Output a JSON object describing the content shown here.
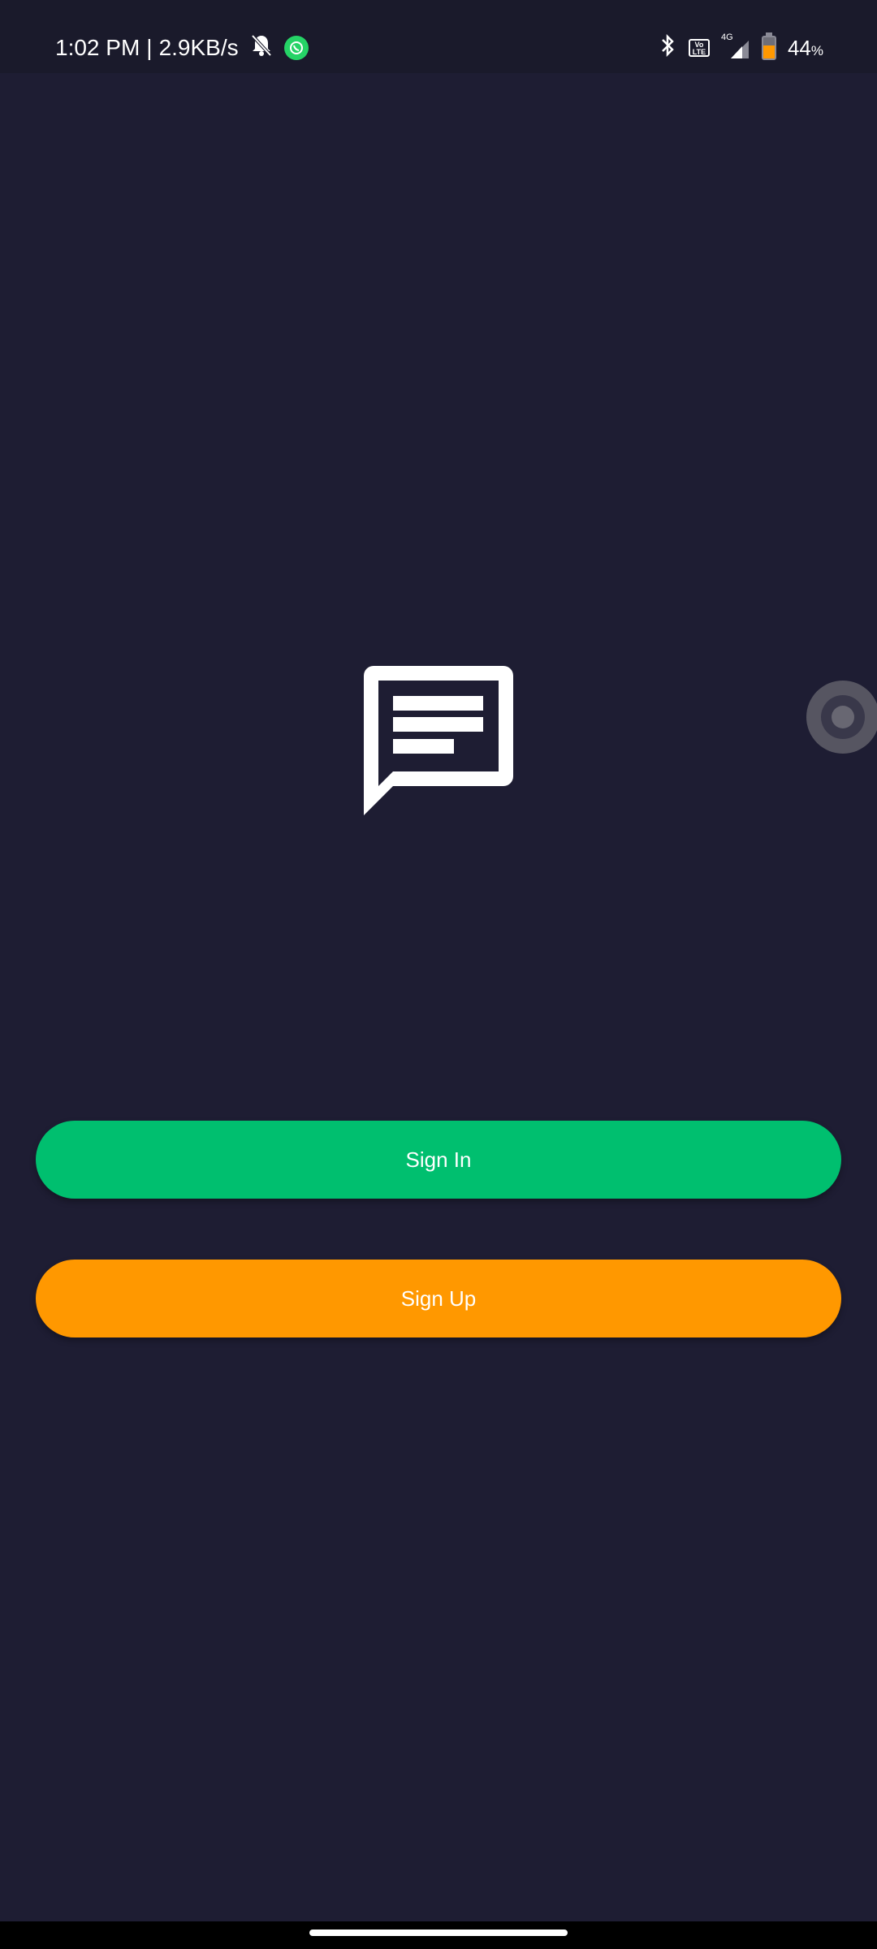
{
  "status_bar": {
    "time": "1:02 PM",
    "separator": "|",
    "network_speed": "2.9KB/s",
    "network_type": "4G",
    "volte_label": "Vo LTE",
    "battery_percent": "44",
    "battery_percent_symbol": "%",
    "icons_left": [
      "bell-off-icon",
      "whatsapp-icon"
    ],
    "icons_right": [
      "bluetooth-icon",
      "volte-icon",
      "signal-icon",
      "battery-icon"
    ]
  },
  "main": {
    "logo_icon": "chat-bubble-icon",
    "sign_in_label": "Sign In",
    "sign_up_label": "Sign Up"
  },
  "colors": {
    "background": "#1e1d33",
    "sign_in": "#00bf6f",
    "sign_up": "#ff9800",
    "whatsapp": "#25d366"
  }
}
